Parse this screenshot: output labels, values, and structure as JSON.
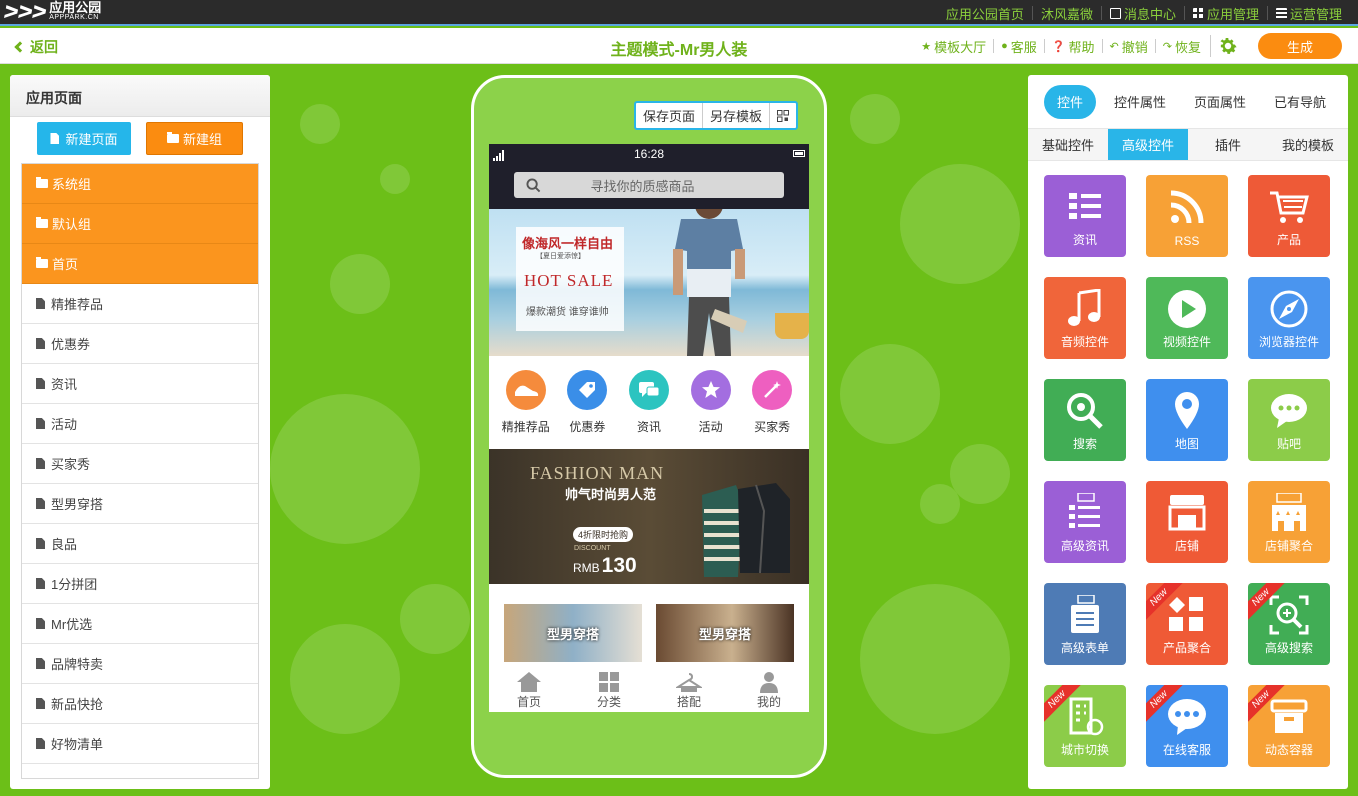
{
  "topbar": {
    "logo_cn": "应用公园",
    "logo_en": "APPPARK.CN",
    "links": [
      "应用公园首页",
      "沐风嘉微",
      "消息中心",
      "应用管理",
      "运营管理"
    ]
  },
  "toolbar": {
    "back": "返回",
    "title": "主题模式-Mr男人装",
    "tools": [
      "模板大厅",
      "客服",
      "帮助",
      "撤销",
      "恢复"
    ],
    "generate": "生成"
  },
  "left_panel": {
    "title": "应用页面",
    "new_page": "新建页面",
    "new_group": "新建组",
    "groups": [
      "系统组",
      "默认组",
      "首页"
    ],
    "pages": [
      "精推荐品",
      "优惠券",
      "资讯",
      "活动",
      "买家秀",
      "型男穿搭",
      "良品",
      "1分拼团",
      "Mr优选",
      "品牌特卖",
      "新品快抢",
      "好物清单"
    ]
  },
  "phone": {
    "toolbar": [
      "保存页面",
      "另存模板"
    ],
    "time": "16:28",
    "search_placeholder": "寻找你的质感商品",
    "banner": {
      "line1": "像海风一样自由",
      "line2": "【夏日爱添惊】",
      "line3": "HOT  SALE",
      "line4": "爆款潮货  谁穿谁帅"
    },
    "icons": [
      {
        "label": "精推荐品",
        "color": "#f58b3c"
      },
      {
        "label": "优惠券",
        "color": "#3a8ee8"
      },
      {
        "label": "资讯",
        "color": "#2cc4c0"
      },
      {
        "label": "活动",
        "color": "#a36ee0"
      },
      {
        "label": "买家秀",
        "color": "#ee5fc0"
      }
    ],
    "fashion": {
      "title": "FASHION MAN",
      "subtitle": "帅气时尚男人范",
      "badge": "4折限时抢购",
      "discount": "DISCOUNT",
      "currency": "RMB",
      "price": "130"
    },
    "tiles": [
      "型男穿搭",
      "型男穿搭"
    ],
    "tabs": [
      "首页",
      "分类",
      "搭配",
      "我的"
    ]
  },
  "right_panel": {
    "tabs": [
      "控件",
      "控件属性",
      "页面属性",
      "已有导航"
    ],
    "subtabs": [
      "基础控件",
      "高级控件",
      "插件",
      "我的模板"
    ],
    "widgets": [
      {
        "label": "资讯",
        "icon": "news-list",
        "color": "#9b5fd6",
        "new": false
      },
      {
        "label": "RSS",
        "icon": "rss",
        "color": "#f7a136",
        "new": false
      },
      {
        "label": "产品",
        "icon": "cart",
        "color": "#ee5a37",
        "new": false
      },
      {
        "label": "音频控件",
        "icon": "music-note",
        "color": "#f0653a",
        "new": false
      },
      {
        "label": "视频控件",
        "icon": "play",
        "color": "#4fb959",
        "new": false
      },
      {
        "label": "浏览器控件",
        "icon": "compass",
        "color": "#4a95ef",
        "new": false
      },
      {
        "label": "搜索",
        "icon": "magnifier",
        "color": "#41ad55",
        "new": false
      },
      {
        "label": "地图",
        "icon": "map-pin",
        "color": "#3f8fee",
        "new": false
      },
      {
        "label": "贴吧",
        "icon": "chat-bubble",
        "color": "#8ccc49",
        "new": false
      },
      {
        "label": "高级资讯",
        "icon": "pro-list",
        "color": "#9b5fd6",
        "new": false
      },
      {
        "label": "店铺",
        "icon": "store",
        "color": "#ef5a36",
        "new": false
      },
      {
        "label": "店铺聚合",
        "icon": "mall",
        "color": "#f7a136",
        "new": false
      },
      {
        "label": "高级表单",
        "icon": "pro-form",
        "color": "#4e7bb5",
        "new": false
      },
      {
        "label": "产品聚合",
        "icon": "blocks",
        "color": "#ef5a36",
        "new": true
      },
      {
        "label": "高级搜索",
        "icon": "scan-search",
        "color": "#41ad55",
        "new": true
      },
      {
        "label": "城市切换",
        "icon": "building",
        "color": "#8ccc49",
        "new": true
      },
      {
        "label": "在线客服",
        "icon": "dots-bubble",
        "color": "#3f8fee",
        "new": true
      },
      {
        "label": "动态容器",
        "icon": "box",
        "color": "#f7a136",
        "new": true
      }
    ],
    "new_badge": "New"
  }
}
